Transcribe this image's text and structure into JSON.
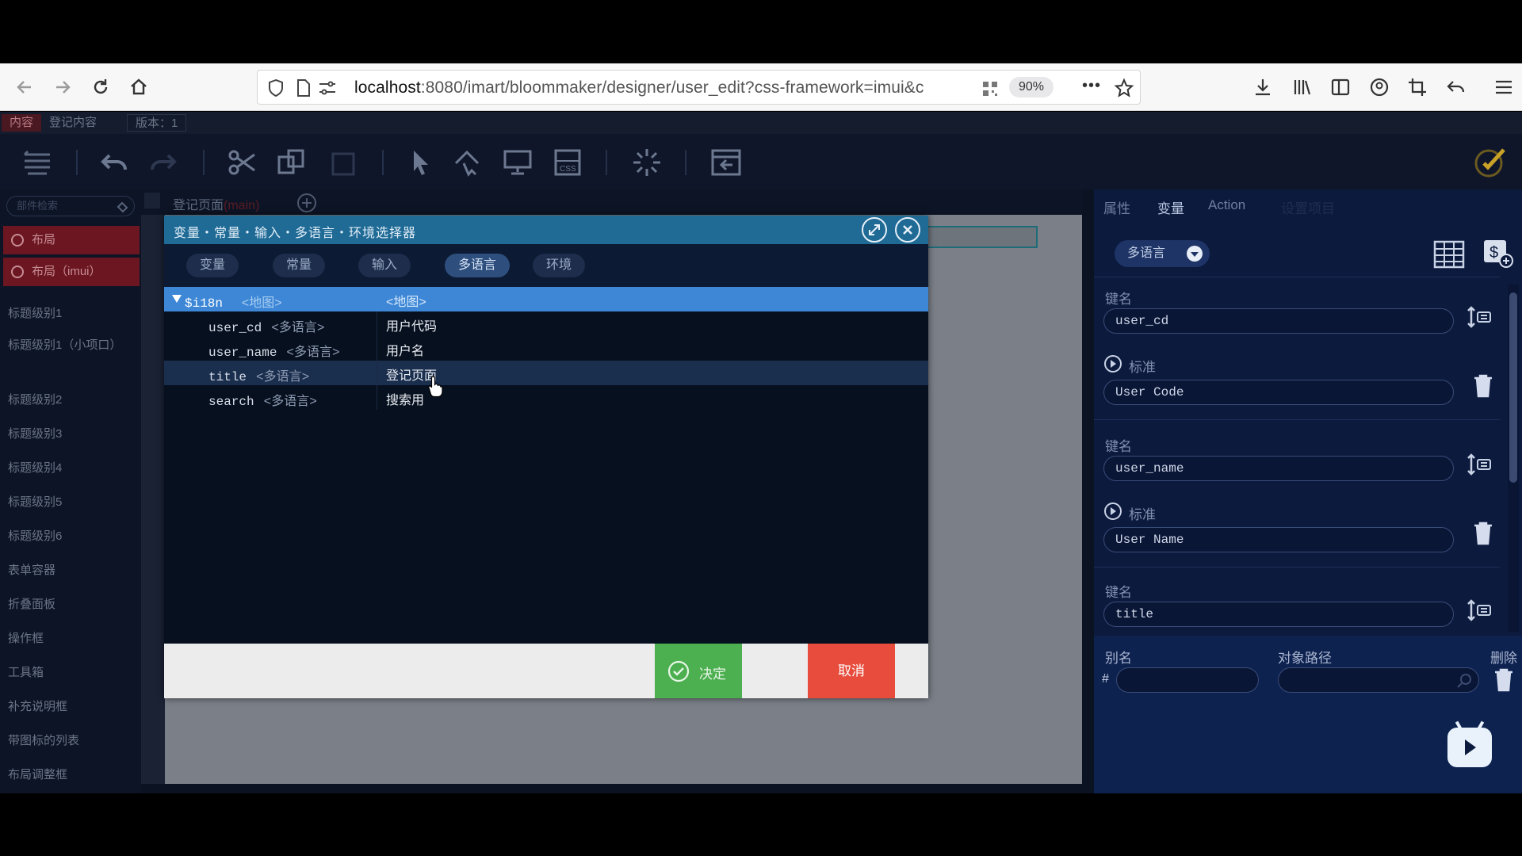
{
  "browser": {
    "url_host": "localhost",
    "url_rest": ":8080/imart/bloommaker/designer/user_edit?css-framework=imui&c",
    "zoom": "90%",
    "more": "•••"
  },
  "app": {
    "strip_tabs": [
      "内容",
      "登记内容",
      "版本：1"
    ],
    "sidebar": {
      "search_placeholder": "部件检索",
      "red_items": [
        "布局",
        "布局（imui）"
      ],
      "items": [
        "标题级别1",
        "标题级别1（小项口）",
        "标题级别2",
        "标题级别3",
        "标题级别4",
        "标题级别5",
        "标题级别6",
        "表单容器",
        "折叠面板",
        "操作框",
        "工具箱",
        "补充说明框",
        "带图标的列表",
        "布局调整框"
      ]
    },
    "canvas": {
      "tab_label": "登记页面",
      "tab_suffix": "(main)"
    },
    "right_panel": {
      "tabs": [
        "属性",
        "变量",
        "Action",
        "设置项目"
      ],
      "active_tab": "变量",
      "dropdown": "多语言",
      "entries": [
        {
          "key_label": "键名",
          "key_value": "user_cd",
          "std_label": "标准",
          "std_value": "User Code"
        },
        {
          "key_label": "键名",
          "key_value": "user_name",
          "std_label": "标准",
          "std_value": "User Name"
        },
        {
          "key_label": "键名",
          "key_value": "title"
        }
      ],
      "alias_label": "别名",
      "path_label": "对象路径",
      "delete_label": "删除",
      "hash": "#"
    }
  },
  "modal": {
    "title": "变量・常量・输入・多语言・环境选择器",
    "tabs": [
      "变量",
      "常量",
      "输入",
      "多语言",
      "环境"
    ],
    "active_tab": "多语言",
    "tree": {
      "root": {
        "key": "$i18n",
        "type": "<地图>",
        "value": "<地图>"
      },
      "rows": [
        {
          "key": "user_cd",
          "type": "<多语言>",
          "value": "用户代码"
        },
        {
          "key": "user_name",
          "type": "<多语言>",
          "value": "用户名"
        },
        {
          "key": "title",
          "type": "<多语言>",
          "value": "登记页面"
        },
        {
          "key": "search",
          "type": "<多语言>",
          "value": "搜索用"
        }
      ]
    },
    "ok_label": "决定",
    "cancel_label": "取消"
  }
}
